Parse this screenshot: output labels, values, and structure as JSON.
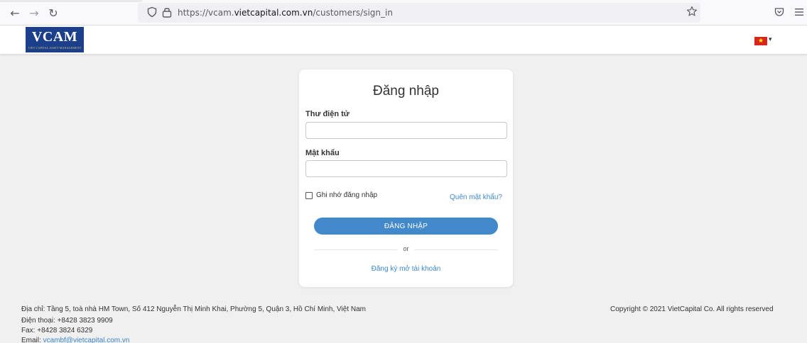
{
  "browser": {
    "url_prefix": "https://vcam.",
    "url_domain": "vietcapital.com.vn",
    "url_path": "/customers/sign_in"
  },
  "header": {
    "logo_text": "VCAM",
    "logo_subtitle": "VIET CAPITAL ASSET MANAGEMENT",
    "language_flag": "★"
  },
  "login": {
    "title": "Đăng nhập",
    "email_label": "Thư điện tử",
    "email_value": "",
    "password_label": "Mật khẩu",
    "password_value": "",
    "remember_label": "Ghi nhớ đăng nhập",
    "forgot_label": "Quên mật khẩu?",
    "submit_label": "ĐĂNG NHẬP",
    "or_text": "or",
    "register_label": "Đăng ký mở tài khoản"
  },
  "footer": {
    "address": "Địa chỉ: Tầng 5, toà nhà HM Town, Số 412 Nguyễn Thị Minh Khai, Phường 5, Quận 3, Hồ Chí Minh, Việt Nam",
    "phone": "Điện thoại: +8428 3823 9909",
    "fax": "Fax: +8428 3824 6329",
    "email_prefix": "Email: ",
    "email_link": "vcambf@vietcapital.com.vn",
    "copyright": "Copyright © 2021 VietCapital Co. All rights reserved"
  }
}
